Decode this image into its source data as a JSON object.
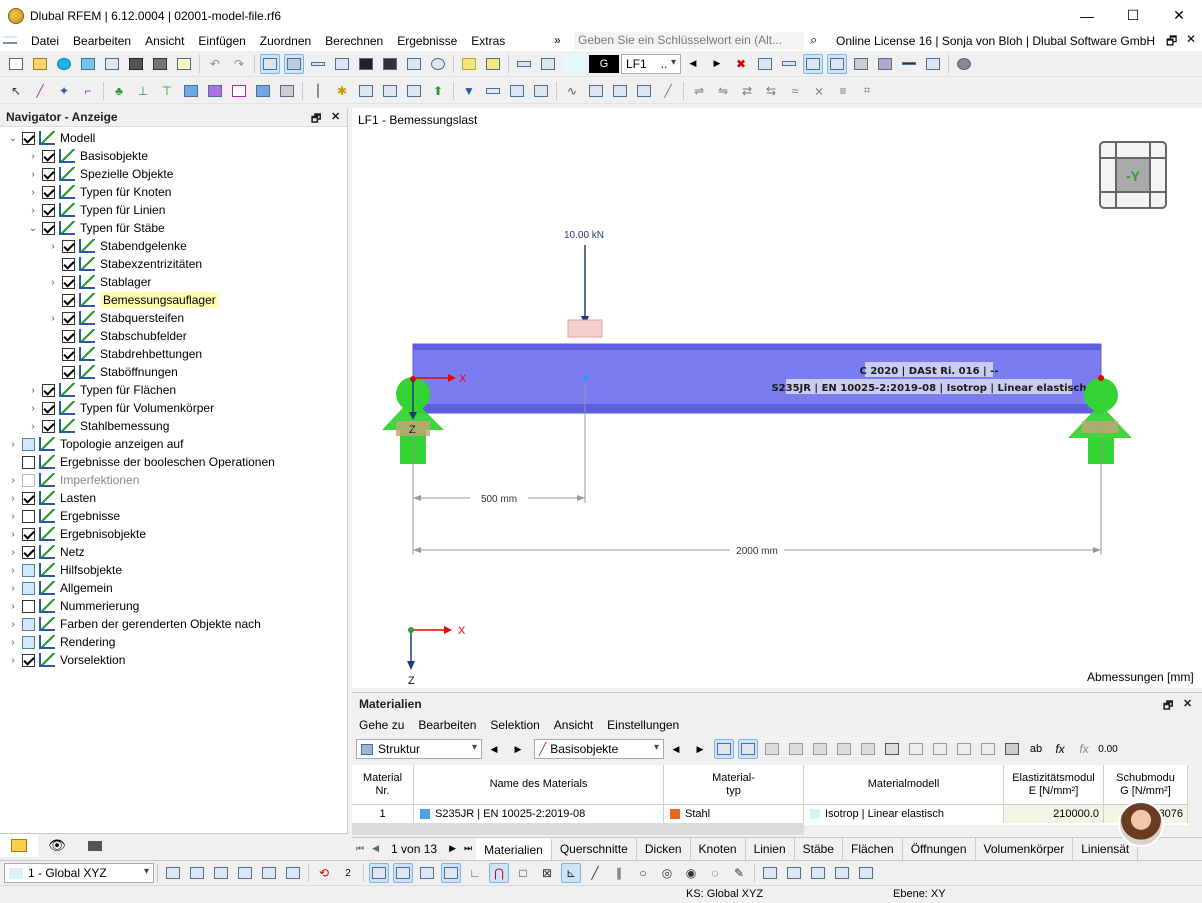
{
  "window": {
    "title": "Dlubal RFEM | 6.12.0004 | 02001-model-file.rf6",
    "minimize": "—",
    "maximize": "☐",
    "close": "✕"
  },
  "menu": {
    "items": [
      "Datei",
      "Bearbeiten",
      "Ansicht",
      "Einfügen",
      "Zuordnen",
      "Berechnen",
      "Ergebnisse",
      "Extras"
    ],
    "more": "»",
    "search_placeholder": "Geben Sie ein Schlüsselwort ein (Alt...",
    "license": "Online License 16 | Sonja von Bloh | Dlubal Software GmbH"
  },
  "toolbar": {
    "load_case_code": "G",
    "load_case": "LF1",
    "load_case_more": ".."
  },
  "navigator": {
    "title": "Navigator - Anzeige",
    "items": [
      {
        "label": "Modell",
        "level": 0,
        "exp": "v",
        "check": "on"
      },
      {
        "label": "Basisobjekte",
        "level": 1,
        "exp": ">",
        "check": "on"
      },
      {
        "label": "Spezielle Objekte",
        "level": 1,
        "exp": ">",
        "check": "on"
      },
      {
        "label": "Typen für Knoten",
        "level": 1,
        "exp": ">",
        "check": "on"
      },
      {
        "label": "Typen für Linien",
        "level": 1,
        "exp": ">",
        "check": "on"
      },
      {
        "label": "Typen für Stäbe",
        "level": 1,
        "exp": "v",
        "check": "on"
      },
      {
        "label": "Stabendgelenke",
        "level": 2,
        "exp": ">",
        "check": "on"
      },
      {
        "label": "Stabexzentrizitäten",
        "level": 2,
        "exp": "",
        "check": "on"
      },
      {
        "label": "Stablager",
        "level": 2,
        "exp": ">",
        "check": "on"
      },
      {
        "label": "Bemessungsauflager",
        "level": 2,
        "exp": "",
        "check": "on",
        "highlight": true
      },
      {
        "label": "Stabquersteifen",
        "level": 2,
        "exp": ">",
        "check": "on"
      },
      {
        "label": "Stabschubfelder",
        "level": 2,
        "exp": "",
        "check": "on"
      },
      {
        "label": "Stabdrehbettungen",
        "level": 2,
        "exp": "",
        "check": "on"
      },
      {
        "label": "Staböffnungen",
        "level": 2,
        "exp": "",
        "check": "on"
      },
      {
        "label": "Typen für Flächen",
        "level": 1,
        "exp": ">",
        "check": "on"
      },
      {
        "label": "Typen für Volumenkörper",
        "level": 1,
        "exp": ">",
        "check": "on"
      },
      {
        "label": "Stahlbemessung",
        "level": 1,
        "exp": ">",
        "check": "on"
      },
      {
        "label": "Topologie anzeigen auf",
        "level": 0,
        "exp": ">",
        "check": "part"
      },
      {
        "label": "Ergebnisse der booleschen Operationen",
        "level": 0,
        "exp": "",
        "check": "off"
      },
      {
        "label": "Imperfektionen",
        "level": 0,
        "exp": ">",
        "check": "dim"
      },
      {
        "label": "Lasten",
        "level": 0,
        "exp": ">",
        "check": "on"
      },
      {
        "label": "Ergebnisse",
        "level": 0,
        "exp": ">",
        "check": "off"
      },
      {
        "label": "Ergebnisobjekte",
        "level": 0,
        "exp": ">",
        "check": "on"
      },
      {
        "label": "Netz",
        "level": 0,
        "exp": ">",
        "check": "on"
      },
      {
        "label": "Hilfsobjekte",
        "level": 0,
        "exp": ">",
        "check": "part"
      },
      {
        "label": "Allgemein",
        "level": 0,
        "exp": ">",
        "check": "part"
      },
      {
        "label": "Nummerierung",
        "level": 0,
        "exp": ">",
        "check": "off"
      },
      {
        "label": "Farben der gerenderten Objekte nach",
        "level": 0,
        "exp": ">",
        "check": "part"
      },
      {
        "label": "Rendering",
        "level": 0,
        "exp": ">",
        "check": "part"
      },
      {
        "label": "Vorselektion",
        "level": 0,
        "exp": ">",
        "check": "on"
      }
    ]
  },
  "view": {
    "title": "LF1 - Bemessungslast",
    "load_label": "10.00 kN",
    "section_label": "C 2020 | DASt Ri. 016 | --",
    "material_label": "S235JR | EN 10025-2:2019-08 | Isotrop | Linear elastisch",
    "dim1": "500 mm",
    "dim2": "2000 mm",
    "axis_x": "X",
    "axis_z": "Z",
    "cube_label": "-Y",
    "units_note": "Abmessungen [mm]"
  },
  "materials": {
    "title": "Materialien",
    "menu": [
      "Gehe zu",
      "Bearbeiten",
      "Selektion",
      "Ansicht",
      "Einstellungen"
    ],
    "combo1": "Struktur",
    "combo2": "Basisobjekte",
    "columns": [
      {
        "l1": "Material",
        "l2": "Nr."
      },
      {
        "l1": "",
        "l2": "Name des Materials"
      },
      {
        "l1": "Material-",
        "l2": "typ"
      },
      {
        "l1": "",
        "l2": "Materialmodell"
      },
      {
        "l1": "Elastizitätsmodul",
        "l2": "E [N/mm²]"
      },
      {
        "l1": "Schubmodu",
        "l2": "G [N/mm²]"
      }
    ],
    "row": {
      "nr": "1",
      "name": "S235JR | EN 10025-2:2019-08",
      "type": "Stahl",
      "model": "Isotrop | Linear elastisch",
      "e": "210000.0",
      "g": "8076"
    },
    "pager": "1 von 13",
    "tabs": [
      "Materialien",
      "Querschnitte",
      "Dicken",
      "Knoten",
      "Linien",
      "Stäbe",
      "Flächen",
      "Öffnungen",
      "Volumenkörper",
      "Liniensät"
    ]
  },
  "bottom": {
    "coord_system": "1 - Global XYZ"
  },
  "status": {
    "ks": "KS: Global XYZ",
    "ebene": "Ebene: XY"
  },
  "colors": {
    "beam": "#7b7cf0",
    "support": "#33d433",
    "selection_highlight": "#fffbb0"
  }
}
